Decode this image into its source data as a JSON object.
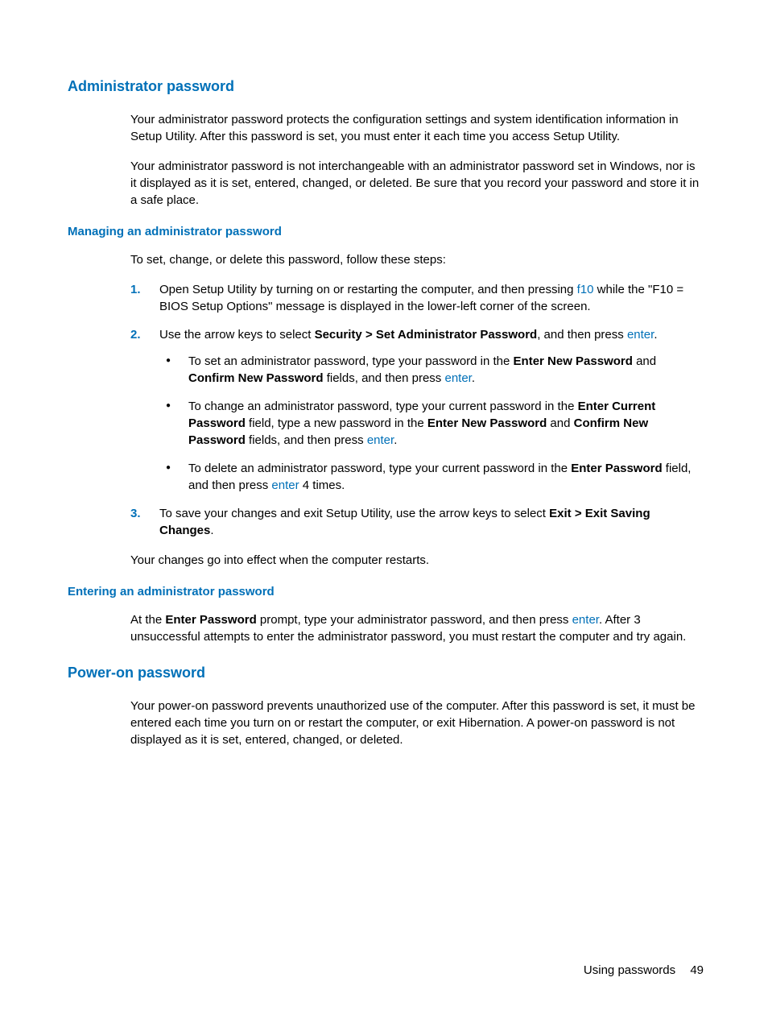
{
  "h_admin": "Administrator password",
  "p1": "Your administrator password protects the configuration settings and system identification information in Setup Utility. After this password is set, you must enter it each time you access Setup Utility.",
  "p2": "Your administrator password is not interchangeable with an administrator password set in Windows, nor is it displayed as it is set, entered, changed, or deleted. Be sure that you record your password and store it in a safe place.",
  "h_manage": "Managing an administrator password",
  "p3": "To set, change, or delete this password, follow these steps:",
  "n1": "1.",
  "n2": "2.",
  "n3": "3.",
  "s1_a": "Open Setup Utility by turning on or restarting the computer, and then pressing ",
  "s1_f10": "f10",
  "s1_b": " while the \"F10 = BIOS Setup Options\" message is displayed in the lower-left corner of the screen.",
  "s2_a": "Use the arrow keys to select ",
  "s2_bold": "Security > Set Administrator Password",
  "s2_b": ", and then press ",
  "s2_enter": "enter",
  "s2_c": ".",
  "b1_a": "To set an administrator password, type your password in the ",
  "b1_bold1": "Enter New Password",
  "b1_b": " and ",
  "b1_bold2": "Confirm New Password",
  "b1_c": " fields, and then press ",
  "b1_enter": "enter",
  "b1_d": ".",
  "b2_a": "To change an administrator password, type your current password in the ",
  "b2_bold1": "Enter Current Password",
  "b2_b": " field, type a new password in the ",
  "b2_bold2": "Enter New Password",
  "b2_c": " and ",
  "b2_bold3": "Confirm New Password",
  "b2_d": " fields, and then press ",
  "b2_enter": "enter",
  "b2_e": ".",
  "b3_a": "To delete an administrator password, type your current password in the ",
  "b3_bold": "Enter Password",
  "b3_b": " field, and then press ",
  "b3_enter": "enter",
  "b3_c": " 4 times.",
  "s3_a": "To save your changes and exit Setup Utility, use the arrow keys to select ",
  "s3_bold": "Exit > Exit Saving Changes",
  "s3_b": ".",
  "p4": "Your changes go into effect when the computer restarts.",
  "h_enter": "Entering an administrator password",
  "p5_a": "At the ",
  "p5_bold": "Enter Password",
  "p5_b": " prompt, type your administrator password, and then press ",
  "p5_enter": "enter",
  "p5_c": ". After 3 unsuccessful attempts to enter the administrator password, you must restart the computer and try again.",
  "h_power": "Power-on password",
  "p6": "Your power-on password prevents unauthorized use of the computer. After this password is set, it must be entered each time you turn on or restart the computer, or exit Hibernation. A power-on password is not displayed as it is set, entered, changed, or deleted.",
  "footer_text": "Using passwords",
  "footer_page": "49"
}
